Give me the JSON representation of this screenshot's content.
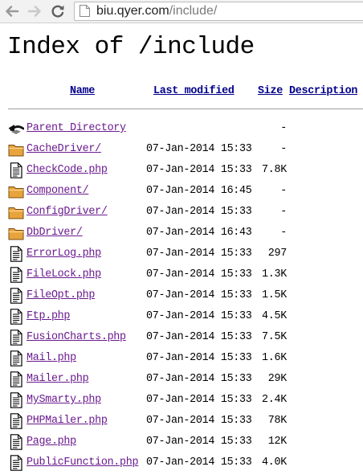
{
  "browser": {
    "url_host": "biu.qyer.com",
    "url_path": "/include/"
  },
  "page": {
    "title": "Index of /include",
    "columns": {
      "name": "Name",
      "last_modified": "Last modified",
      "size": "Size",
      "description": "Description"
    },
    "rows": [
      {
        "icon": "parent-directory-icon",
        "name": "Parent Directory",
        "modified": "",
        "size": "-"
      },
      {
        "icon": "folder-icon",
        "name": "CacheDriver/",
        "modified": "07-Jan-2014 15:33",
        "size": "-"
      },
      {
        "icon": "file-icon",
        "name": "CheckCode.php",
        "modified": "07-Jan-2014 15:33",
        "size": "7.8K"
      },
      {
        "icon": "folder-icon",
        "name": "Component/",
        "modified": "07-Jan-2014 16:45",
        "size": "-"
      },
      {
        "icon": "folder-icon",
        "name": "ConfigDriver/",
        "modified": "07-Jan-2014 15:33",
        "size": "-"
      },
      {
        "icon": "folder-icon",
        "name": "DbDriver/",
        "modified": "07-Jan-2014 16:43",
        "size": "-"
      },
      {
        "icon": "file-icon",
        "name": "ErrorLog.php",
        "modified": "07-Jan-2014 15:33",
        "size": "297"
      },
      {
        "icon": "file-icon",
        "name": "FileLock.php",
        "modified": "07-Jan-2014 15:33",
        "size": "1.3K"
      },
      {
        "icon": "file-icon",
        "name": "FileOpt.php",
        "modified": "07-Jan-2014 15:33",
        "size": "1.5K"
      },
      {
        "icon": "file-icon",
        "name": "Ftp.php",
        "modified": "07-Jan-2014 15:33",
        "size": "4.5K"
      },
      {
        "icon": "file-icon",
        "name": "FusionCharts.php",
        "modified": "07-Jan-2014 15:33",
        "size": "7.5K"
      },
      {
        "icon": "file-icon",
        "name": "Mail.php",
        "modified": "07-Jan-2014 15:33",
        "size": "1.6K"
      },
      {
        "icon": "file-icon",
        "name": "Mailer.php",
        "modified": "07-Jan-2014 15:33",
        "size": "29K"
      },
      {
        "icon": "file-icon",
        "name": "MySmarty.php",
        "modified": "07-Jan-2014 15:33",
        "size": "2.4K"
      },
      {
        "icon": "file-icon",
        "name": "PHPMailer.php",
        "modified": "07-Jan-2014 15:33",
        "size": "78K"
      },
      {
        "icon": "file-icon",
        "name": "Page.php",
        "modified": "07-Jan-2014 15:33",
        "size": "12K"
      },
      {
        "icon": "file-icon",
        "name": "PublicFunction.php",
        "modified": "07-Jan-2014 15:33",
        "size": "4.0K"
      }
    ]
  },
  "colors": {
    "visited_link": "#6a1a8e",
    "header_link": "#00008b",
    "folder": "#e8a43c"
  }
}
